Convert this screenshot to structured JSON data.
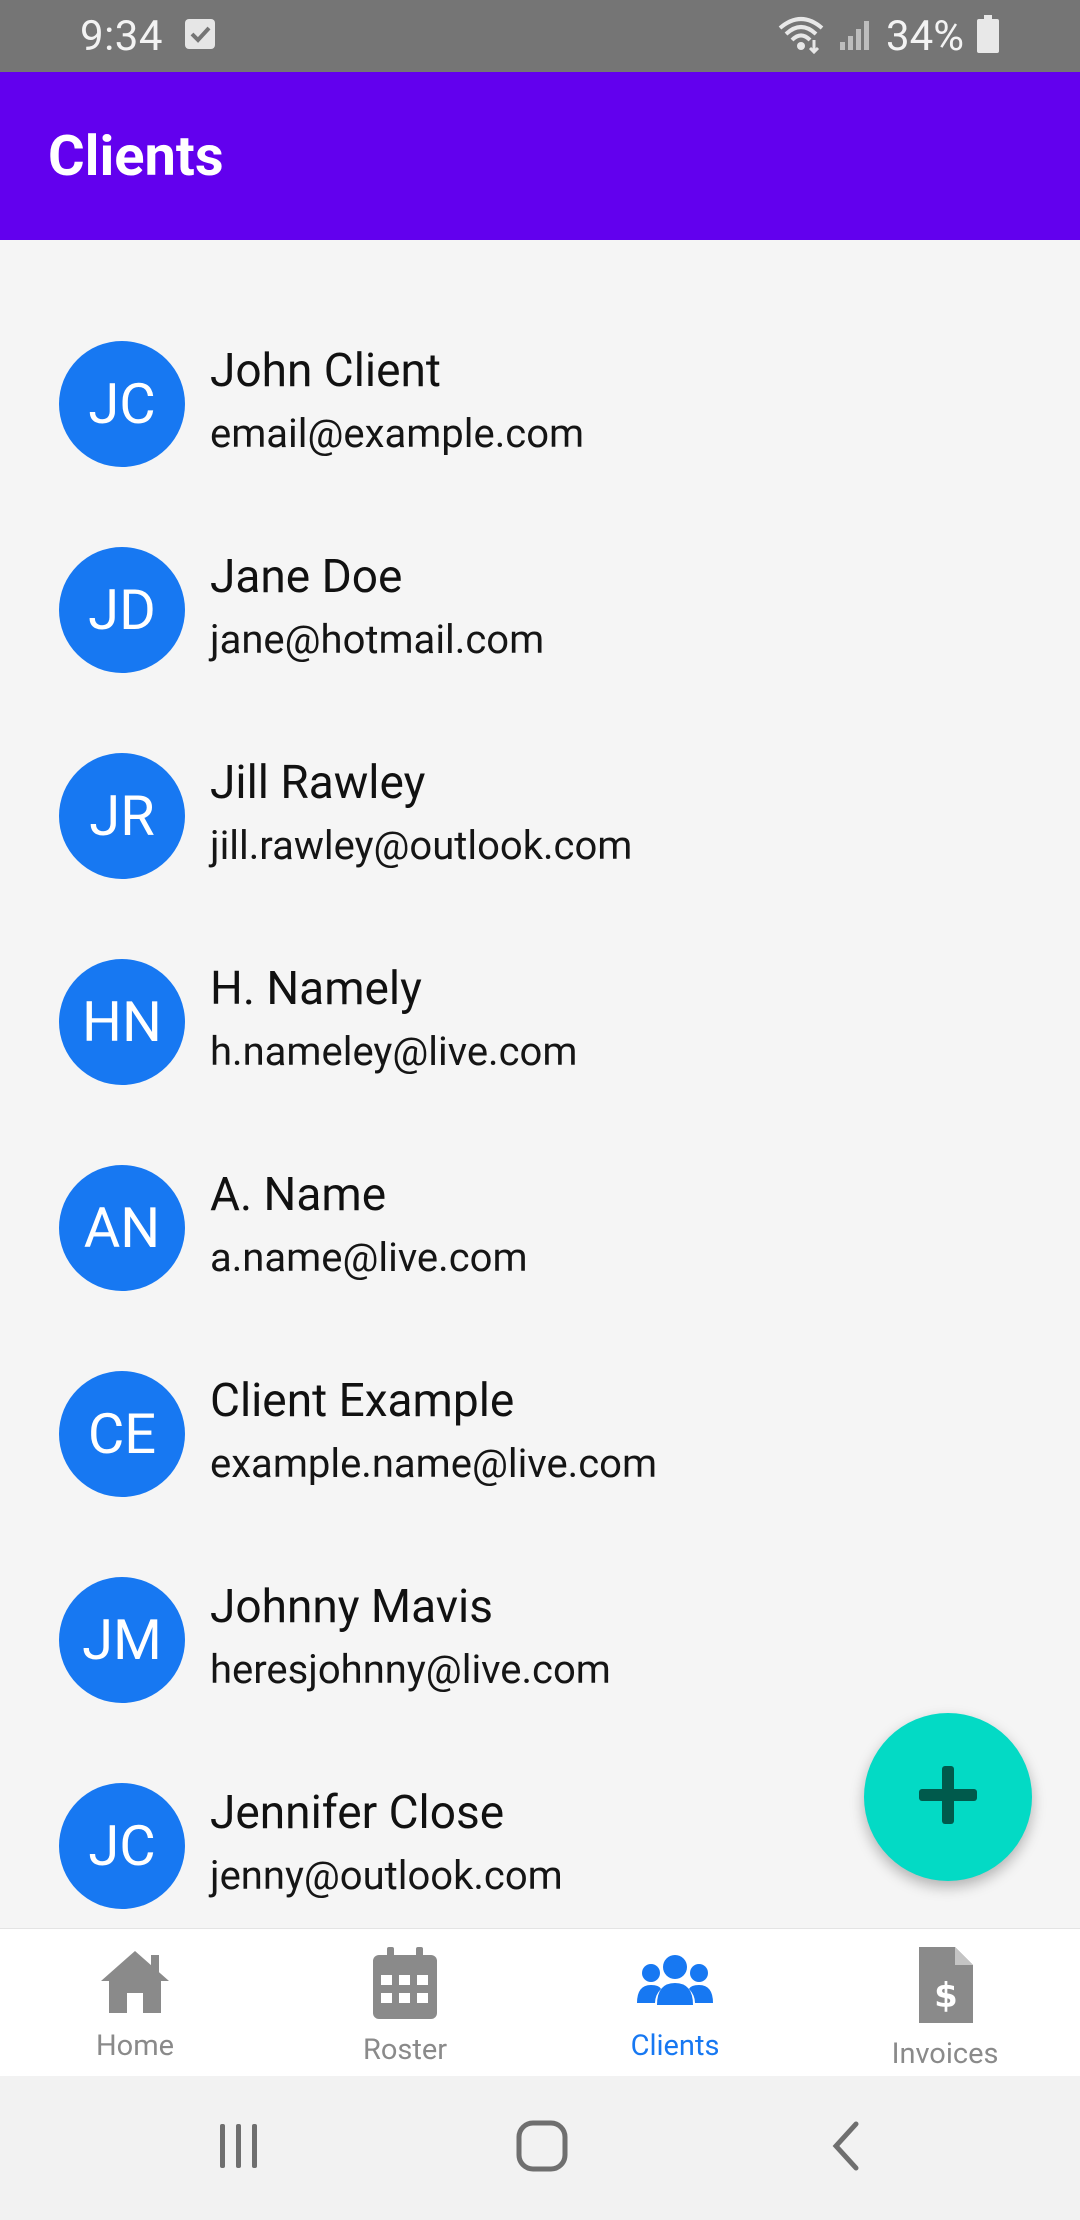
{
  "status_bar": {
    "time": "9:34",
    "battery": "34%"
  },
  "app_bar": {
    "title": "Clients"
  },
  "clients": [
    {
      "initials": "JC",
      "name": "John Client",
      "email": "email@example.com"
    },
    {
      "initials": "JD",
      "name": "Jane Doe",
      "email": "jane@hotmail.com"
    },
    {
      "initials": "JR",
      "name": "Jill Rawley",
      "email": "jill.rawley@outlook.com"
    },
    {
      "initials": "HN",
      "name": "H. Namely",
      "email": "h.nameley@live.com"
    },
    {
      "initials": "AN",
      "name": "A. Name",
      "email": "a.name@live.com"
    },
    {
      "initials": "CE",
      "name": "Client Example",
      "email": "example.name@live.com"
    },
    {
      "initials": "JM",
      "name": "Johnny Mavis",
      "email": "heresjohnny@live.com"
    },
    {
      "initials": "JC",
      "name": "Jennifer Close",
      "email": "jenny@outlook.com"
    }
  ],
  "fab": {
    "icon": "plus-icon"
  },
  "bottom_nav": {
    "items": [
      {
        "label": "Home",
        "icon": "home-icon"
      },
      {
        "label": "Roster",
        "icon": "calendar-icon"
      },
      {
        "label": "Clients",
        "icon": "users-icon"
      },
      {
        "label": "Invoices",
        "icon": "invoice-icon"
      }
    ],
    "active_index": 2
  },
  "colors": {
    "app_bar": "#6200ee",
    "avatar": "#1778f2",
    "fab": "#03dac5",
    "active_nav": "#1778f2",
    "inactive_nav": "#8a8a8a"
  }
}
